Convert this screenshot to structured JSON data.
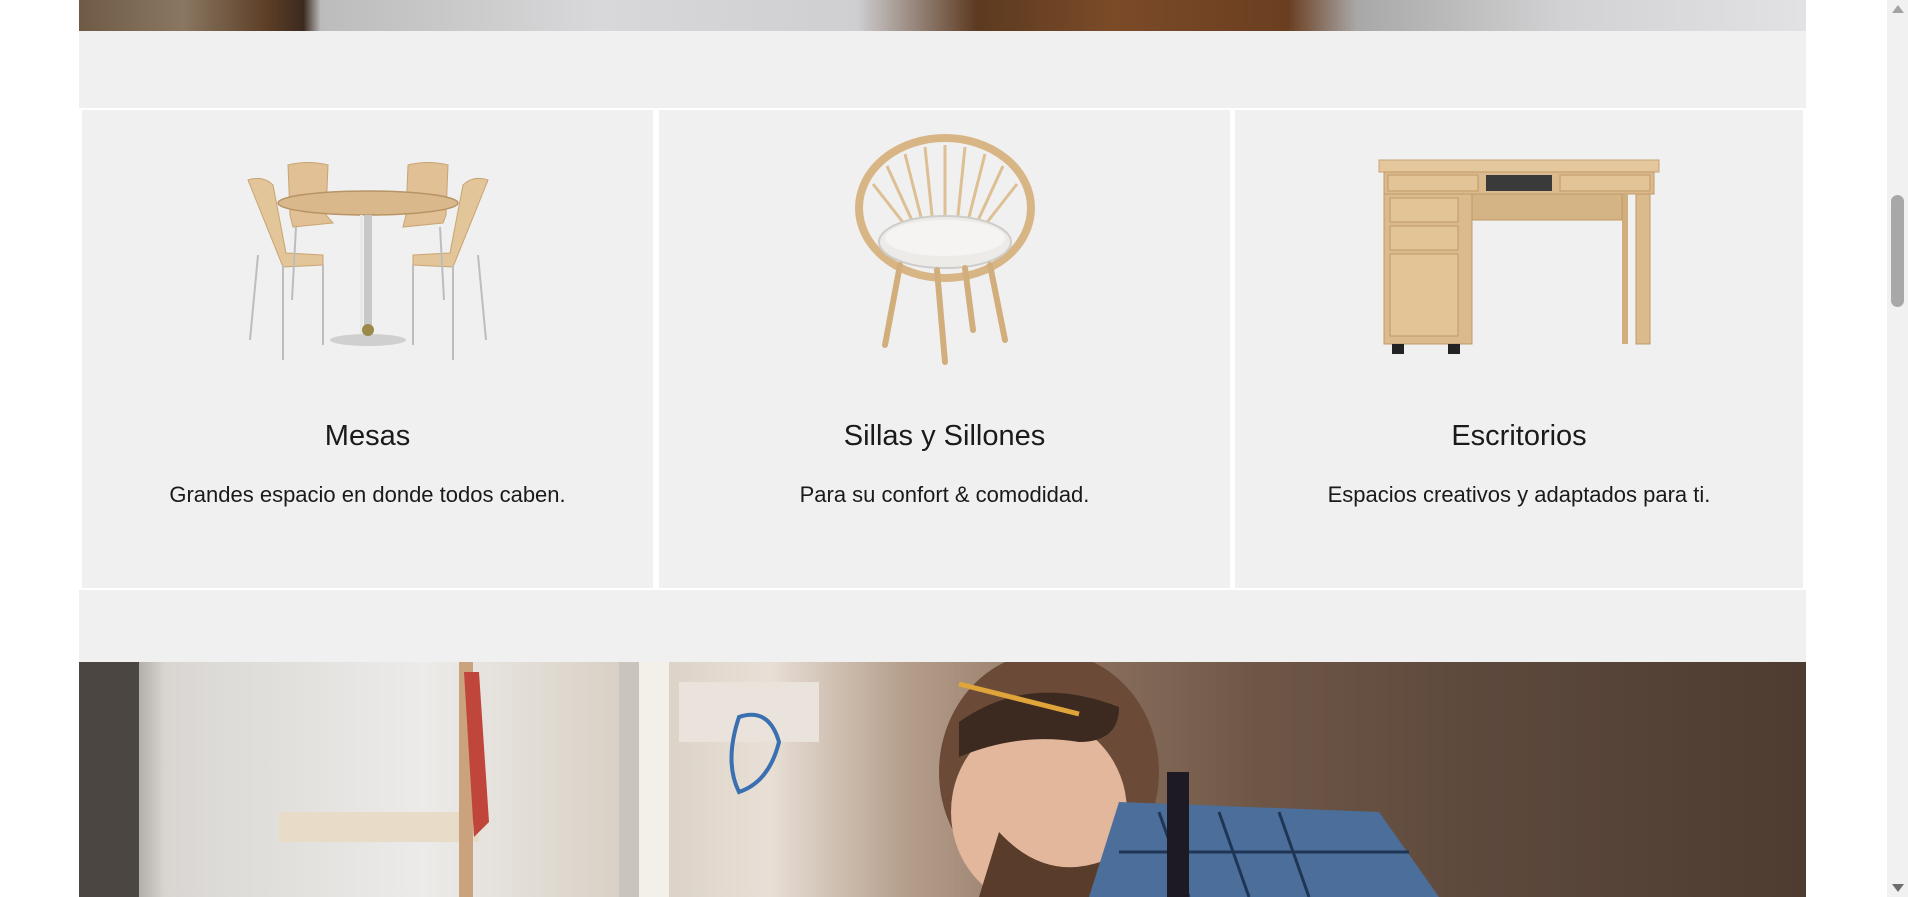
{
  "categories": [
    {
      "title": "Mesas",
      "description": "Grandes espacio en donde todos caben.",
      "image_icon": "dining-table-with-chairs"
    },
    {
      "title": "Sillas y Sillones",
      "description": "Para su confort & comodidad.",
      "image_icon": "round-armchair"
    },
    {
      "title": "Escritorios",
      "description": "Espacios creativos y adaptados para ti.",
      "image_icon": "wooden-desk"
    }
  ],
  "colors": {
    "card_background": "#f0f0f0",
    "text": "#1a1a1a",
    "wood": "#d9b98c"
  }
}
